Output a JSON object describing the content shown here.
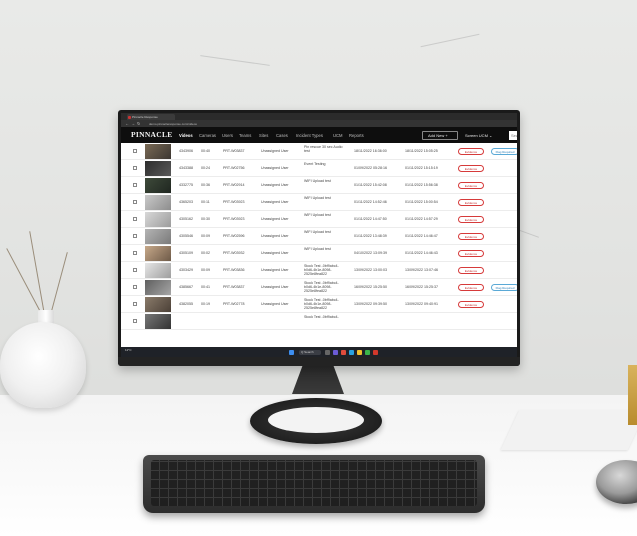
{
  "browser": {
    "tab_title": "Pinnacle Response",
    "url": "demo.pinnacleresponse.com/videos"
  },
  "app": {
    "logo": "PINNACLE",
    "nav": [
      "Videos",
      "Cameras",
      "Users",
      "Teams",
      "Sites",
      "Cases",
      "Incident Types",
      "UCM",
      "Reports"
    ],
    "active_nav": "Videos",
    "add_new": "Add New  +",
    "user": "Screen UCM  ⌄",
    "search_placeholder": "Search"
  },
  "rows": [
    {
      "id": "4343906",
      "dur": "00:40",
      "device": "PRT-W03837",
      "user": "Unassigned User",
      "title": "Pin rescue 30 sec Audio test",
      "recorded": "18/11/2022 16:36:00",
      "uploaded": "18/11/2022 15:05:25",
      "evidence": "Evidence",
      "flag": "Flag Required"
    },
    {
      "id": "4343388",
      "dur": "00:24",
      "device": "PRT-W02756",
      "user": "Unassigned User",
      "title": "Event Testing",
      "recorded": "01/09/2022 05:28:16",
      "uploaded": "01/11/2022 15:15:19",
      "evidence": "Evidence",
      "flag": ""
    },
    {
      "id": "4332775",
      "dur": "00:36",
      "device": "PRT-W02914",
      "user": "Unassigned User",
      "title": "WIFI Upload test",
      "recorded": "01/11/2022 15:42:08",
      "uploaded": "01/11/2022 15:56:38",
      "evidence": "Evidence",
      "flag": ""
    },
    {
      "id": "4365203",
      "dur": "00:11",
      "device": "PRT-W03923",
      "user": "Unassigned User",
      "title": "WIFI Upload test",
      "recorded": "01/11/2022 14:52:46",
      "uploaded": "01/11/2022 15:00:54",
      "evidence": "Evidence",
      "flag": ""
    },
    {
      "id": "4305162",
      "dur": "00:30",
      "device": "PRT-W03923",
      "user": "Unassigned User",
      "title": "WIFI Upload test",
      "recorded": "01/11/2022 14:47:50",
      "uploaded": "01/11/2022 14:57:29",
      "evidence": "Evidence",
      "flag": ""
    },
    {
      "id": "4305546",
      "dur": "00:09",
      "device": "PRT-W02596",
      "user": "Unassigned User",
      "title": "WIFI Upload test",
      "recorded": "01/11/2022 13:48:39",
      "uploaded": "01/11/2022 14:46:47",
      "evidence": "Evidence",
      "flag": ""
    },
    {
      "id": "4305109",
      "dur": "00:02",
      "device": "PRT-W03932",
      "user": "Unassigned User",
      "title": "WIFI Upload test",
      "recorded": "04/10/2022 13:09:39",
      "uploaded": "01/11/2022 14:46:43",
      "evidence": "Evidence",
      "flag": ""
    },
    {
      "id": "4303429",
      "dur": "00:09",
      "device": "PRT-W03836",
      "user": "Unassigned User",
      "title": "Stock Test -0bf9abc4-b0d6-4b1e-8098-2525e8fea822",
      "recorded": "13/09/2022 13:00:03",
      "uploaded": "13/09/2022 13:07:46",
      "evidence": "Evidence",
      "flag": ""
    },
    {
      "id": "4385667",
      "dur": "00:41",
      "device": "PRT-W03837",
      "user": "Unassigned User",
      "title": "Stock Test -0bf9abc4-b0d6-4b1e-8098-2525e8fea822",
      "recorded": "16/09/2022 15:25:50",
      "uploaded": "16/09/2022 15:25:37",
      "evidence": "Evidence",
      "flag": "Flag Required"
    },
    {
      "id": "4382055",
      "dur": "00:19",
      "device": "PRT-W02778",
      "user": "Unassigned User",
      "title": "Stock Test -0bf9abc4-b0d6-4b1e-8098-2525e8fea822",
      "recorded": "13/09/2022 09:39:50",
      "uploaded": "13/09/2022 09:40:91",
      "evidence": "Evidence",
      "flag": ""
    },
    {
      "id": "",
      "dur": "",
      "device": "",
      "user": "",
      "title": "Stock Test -0bf9abc4-",
      "recorded": "",
      "uploaded": "",
      "evidence": "",
      "flag": ""
    }
  ],
  "taskbar": {
    "weather": "11°C",
    "search": "Q Search"
  },
  "colors": {
    "appbar": "#0e0e0e",
    "evidence": "#d63a3a",
    "flag": "#5aa9d6"
  }
}
